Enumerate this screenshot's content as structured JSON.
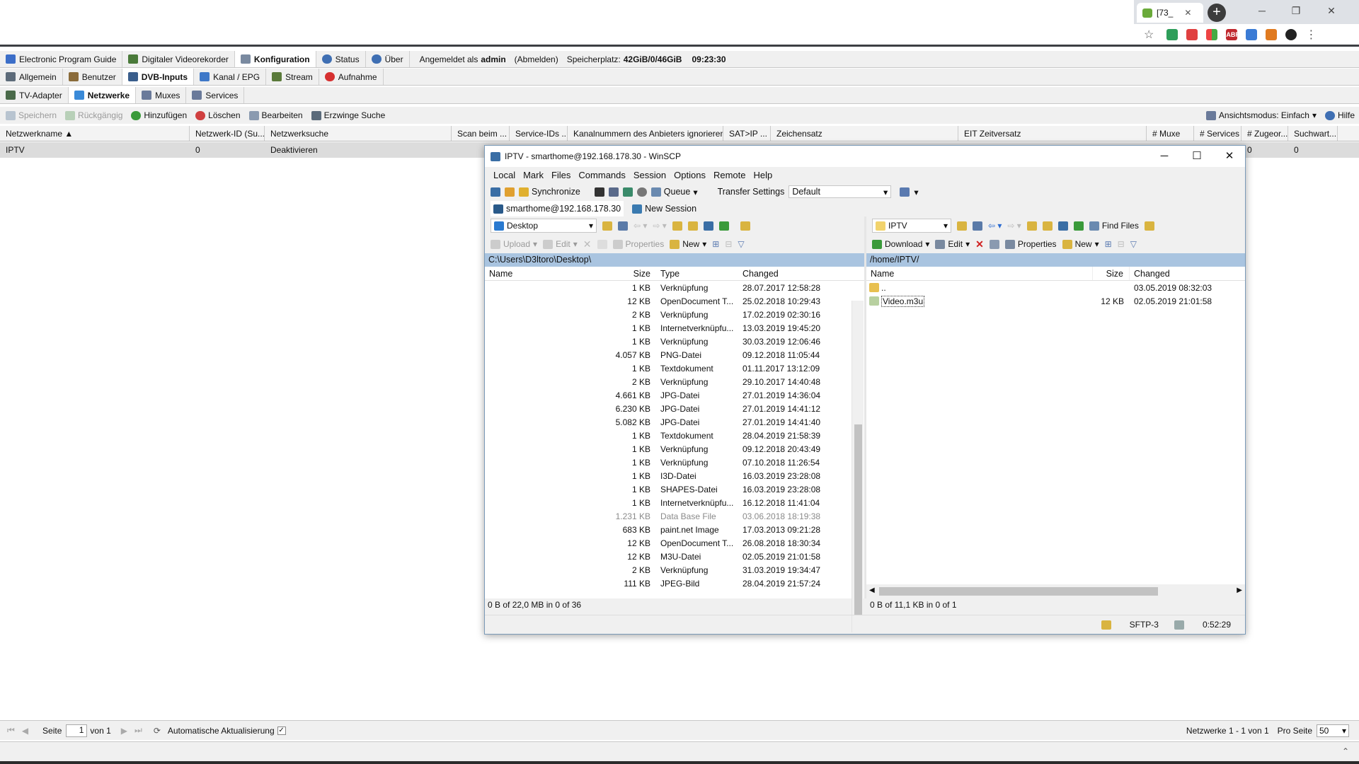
{
  "browser": {
    "tab_title": "[73_",
    "new_tab": "+",
    "win_min": "─",
    "win_restore": "❐",
    "win_close": "✕",
    "abp_label": "ABP"
  },
  "tvh": {
    "main_tabs": [
      {
        "label": "Electronic Program Guide",
        "icon": "epg-icon",
        "color": "#3c6ec8"
      },
      {
        "label": "Digitaler Videorekorder",
        "icon": "recorder-icon",
        "color": "#4a7a3a"
      },
      {
        "label": "Konfiguration",
        "icon": "wrench-icon",
        "color": "#7a8aa0"
      },
      {
        "label": "Status",
        "icon": "eye-icon",
        "color": "#3f6fb3"
      },
      {
        "label": "Über",
        "icon": "info-icon",
        "color": "#3f6fb3"
      }
    ],
    "login_prefix": "Angemeldet als",
    "login_user": "admin",
    "logout": "(Abmelden)",
    "storage_label": "Speicherplatz:",
    "storage_value": "42GiB/0/46GiB",
    "time": "09:23:30",
    "config_tabs": [
      {
        "label": "Allgemein",
        "color": "#5d6b7a"
      },
      {
        "label": "Benutzer",
        "color": "#8a6b3a"
      },
      {
        "label": "DVB-Inputs",
        "color": "#3a5e8c"
      },
      {
        "label": "Kanal / EPG",
        "color": "#3e78c8"
      },
      {
        "label": "Stream",
        "color": "#5a7a3a"
      },
      {
        "label": "Aufnahme",
        "color": "#d63030"
      }
    ],
    "dvb_tabs": [
      {
        "label": "TV-Adapter",
        "color": "#4a6a4a"
      },
      {
        "label": "Netzwerke",
        "color": "#3a8ad8"
      },
      {
        "label": "Muxes",
        "color": "#6a7a9a"
      },
      {
        "label": "Services",
        "color": "#6a7a9a"
      }
    ],
    "toolbar": {
      "save": "Speichern",
      "undo": "Rückgängig",
      "add": "Hinzufügen",
      "delete": "Löschen",
      "edit": "Bearbeiten",
      "force_scan": "Erzwinge Suche",
      "view_mode": "Ansichtsmodus: Einfach",
      "help": "Hilfe"
    },
    "columns": [
      "Netzwerkname ▲",
      "Netzwerk-ID (Su...",
      "Netzwerksuche",
      "Scan beim ...",
      "Service-IDs ...",
      "Kanalnummern des Anbieters ignorieren",
      "SAT>IP ...",
      "Zeichensatz",
      "EIT Zeitversatz",
      "# Muxe",
      "# Services",
      "# Zugeor...",
      "Suchwart..."
    ],
    "row": [
      "IPTV",
      "0",
      "Deaktivieren",
      "",
      "",
      "",
      "",
      "",
      "",
      "",
      "",
      "0",
      "0"
    ],
    "pager": {
      "page_label": "Seite",
      "page_value": "1",
      "page_of": "von 1",
      "auto_refresh": "Automatische Aktualisierung",
      "summary": "Netzwerke 1 - 1 von 1",
      "per_page_label": "Pro Seite",
      "per_page_value": "50"
    }
  },
  "winscp": {
    "title": "IPTV - smarthome@192.168.178.30 - WinSCP",
    "menu": [
      "Local",
      "Mark",
      "Files",
      "Commands",
      "Session",
      "Options",
      "Remote",
      "Help"
    ],
    "synchronize": "Synchronize",
    "queue": "Queue",
    "transfer_settings_label": "Transfer Settings",
    "transfer_settings_value": "Default",
    "session_tab": "smarthome@192.168.178.30",
    "new_session": "New Session",
    "local": {
      "location": "Desktop",
      "upload": "Upload",
      "edit": "Edit",
      "properties": "Properties",
      "new": "New",
      "path": "C:\\Users\\D3ltoro\\Desktop\\",
      "columns": [
        "Name",
        "Size",
        "Type",
        "Changed"
      ],
      "files": [
        {
          "size": "1 KB",
          "type": "Verknüpfung",
          "changed": "28.07.2017  12:58:28"
        },
        {
          "size": "12 KB",
          "type": "OpenDocument T...",
          "changed": "25.02.2018  10:29:43"
        },
        {
          "size": "2 KB",
          "type": "Verknüpfung",
          "changed": "17.02.2019  02:30:16"
        },
        {
          "size": "1 KB",
          "type": "Internetverknüpfu...",
          "changed": "13.03.2019  19:45:20"
        },
        {
          "size": "1 KB",
          "type": "Verknüpfung",
          "changed": "30.03.2019  12:06:46"
        },
        {
          "size": "4.057 KB",
          "type": "PNG-Datei",
          "changed": "09.12.2018  11:05:44"
        },
        {
          "size": "1 KB",
          "type": "Textdokument",
          "changed": "01.11.2017  13:12:09"
        },
        {
          "size": "2 KB",
          "type": "Verknüpfung",
          "changed": "29.10.2017  14:40:48"
        },
        {
          "size": "4.661 KB",
          "type": "JPG-Datei",
          "changed": "27.01.2019  14:36:04"
        },
        {
          "size": "6.230 KB",
          "type": "JPG-Datei",
          "changed": "27.01.2019  14:41:12"
        },
        {
          "size": "5.082 KB",
          "type": "JPG-Datei",
          "changed": "27.01.2019  14:41:40"
        },
        {
          "size": "1 KB",
          "type": "Textdokument",
          "changed": "28.04.2019  21:58:39"
        },
        {
          "size": "1 KB",
          "type": "Verknüpfung",
          "changed": "09.12.2018  20:43:49"
        },
        {
          "size": "1 KB",
          "type": "Verknüpfung",
          "changed": "07.10.2018  11:26:54"
        },
        {
          "size": "1 KB",
          "type": "I3D-Datei",
          "changed": "16.03.2019  23:28:08"
        },
        {
          "size": "1 KB",
          "type": "SHAPES-Datei",
          "changed": "16.03.2019  23:28:08"
        },
        {
          "size": "1 KB",
          "type": "Internetverknüpfu...",
          "changed": "16.12.2018  11:41:04"
        },
        {
          "size": "1.231 KB",
          "type": "Data Base File",
          "changed": "03.06.2018  18:19:38",
          "dim": true
        },
        {
          "size": "683 KB",
          "type": "paint.net Image",
          "changed": "17.03.2013  09:21:28"
        },
        {
          "size": "12 KB",
          "type": "OpenDocument T...",
          "changed": "26.08.2018  18:30:34"
        },
        {
          "size": "12 KB",
          "type": "M3U-Datei",
          "changed": "02.05.2019  21:01:58"
        },
        {
          "size": "2 KB",
          "type": "Verknüpfung",
          "changed": "31.03.2019  19:34:47"
        },
        {
          "size": "111 KB",
          "type": "JPEG-Bild",
          "changed": "28.04.2019  21:57:24"
        }
      ],
      "status": "0 B of 22,0 MB in 0 of 36"
    },
    "remote": {
      "location": "IPTV",
      "find_files": "Find Files",
      "download": "Download",
      "edit": "Edit",
      "properties": "Properties",
      "new": "New",
      "path": "/home/IPTV/",
      "columns": [
        "Name",
        "Size",
        "Changed"
      ],
      "files": [
        {
          "name": "..",
          "size": "",
          "changed": "03.05.2019  08:32:03",
          "icon": "parent-dir-icon"
        },
        {
          "name": "Video.m3u",
          "size": "12 KB",
          "changed": "02.05.2019  21:01:58",
          "icon": "m3u-file-icon"
        }
      ],
      "status": "0 B of 11,1 KB in 0 of 1"
    },
    "protocol": "SFTP-3",
    "elapsed": "0:52:29"
  }
}
